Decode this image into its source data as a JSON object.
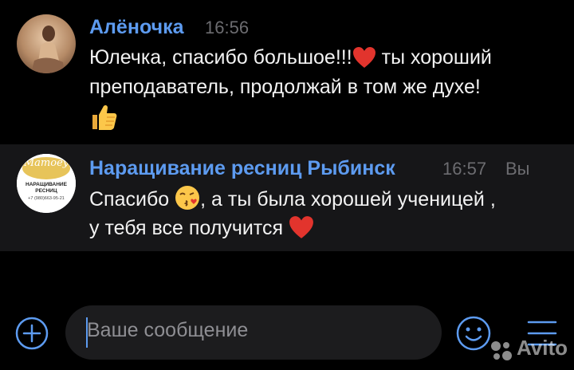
{
  "messages": [
    {
      "author": "Алёночка",
      "time": "16:56",
      "lines": [
        "Юлечка, спасибо большое!!!",
        " ты хороший",
        "преподаватель, продолжай в том же духе!"
      ],
      "emojis": [
        "heart-emoji",
        "thumbs-up-emoji"
      ]
    },
    {
      "author": "Наращивание ресниц Рыбинск",
      "time": "16:57",
      "you_label": "Вы",
      "lines": [
        "Спасибо ",
        ", а ты была хорошей ученицей ,",
        "у тебя все получится "
      ],
      "emojis": [
        "kiss-emoji",
        "heart-emoji"
      ],
      "avatar_text": {
        "logo": "Mamoey",
        "tagline": "beauty studio",
        "title_line1": "НАРАЩИВАНИЕ",
        "title_line2": "РЕСНИЦ",
        "phone": "+7 (980)663-95-21"
      }
    }
  ],
  "composer": {
    "placeholder": "Ваше сообщение"
  },
  "watermark": "Avito",
  "colors": {
    "accent": "#5d9bf0",
    "background": "#000000",
    "highlight_row": "#161618",
    "field": "#1c1c1e",
    "muted": "#6c6c70"
  }
}
